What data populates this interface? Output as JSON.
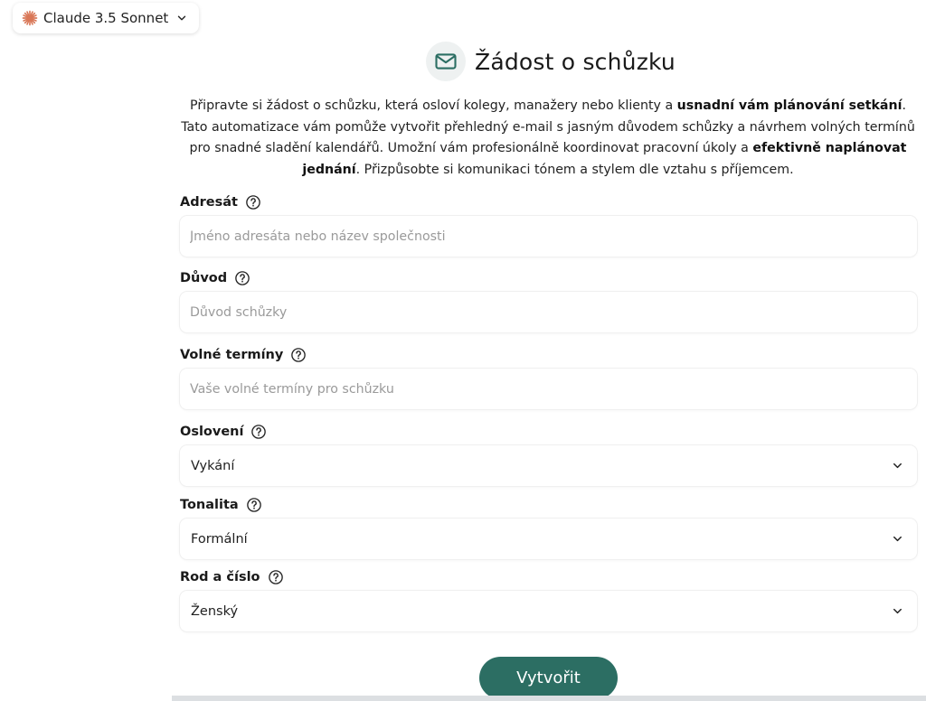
{
  "model_selector": {
    "label": "Claude 3.5 Sonnet",
    "icon": "claude-spark-icon",
    "accent": "#d97757"
  },
  "header": {
    "icon": "mail-icon",
    "title": "Žádost o schůzku",
    "accent": "#2c6e63"
  },
  "intro": {
    "p1": "Připravte si žádost o schůzku, která osloví kolegy, manažery nebo klienty a ",
    "b1": "usnadní vám plánování setkání",
    "p2": ". Tato automatizace vám pomůže vytvořit přehledný e-mail s jasným důvodem schůzky a návrhem volných termínů pro snadné sladění kalendářů. Umožní vám profesionálně koordinovat pracovní úkoly a ",
    "b2": "efektivně naplánovat jednání",
    "p3": ". Přizpůsobte si komunikaci tónem a stylem dle vztahu s příjemcem."
  },
  "fields": {
    "adresat": {
      "label": "Adresát",
      "value": "",
      "placeholder": "Jméno adresáta nebo název společnosti"
    },
    "duvod": {
      "label": "Důvod",
      "value": "",
      "placeholder": "Důvod schůzky"
    },
    "terminy": {
      "label": "Volné termíny",
      "value": "",
      "placeholder": "Vaše volné termíny pro schůzku"
    },
    "osloveni": {
      "label": "Oslovení",
      "selected": "Vykání"
    },
    "tonalita": {
      "label": "Tonalita",
      "selected": "Formální"
    },
    "rod": {
      "label": "Rod a číslo",
      "selected": "Ženský"
    }
  },
  "submit": {
    "label": "Vytvořit",
    "color": "#2c6e63"
  }
}
